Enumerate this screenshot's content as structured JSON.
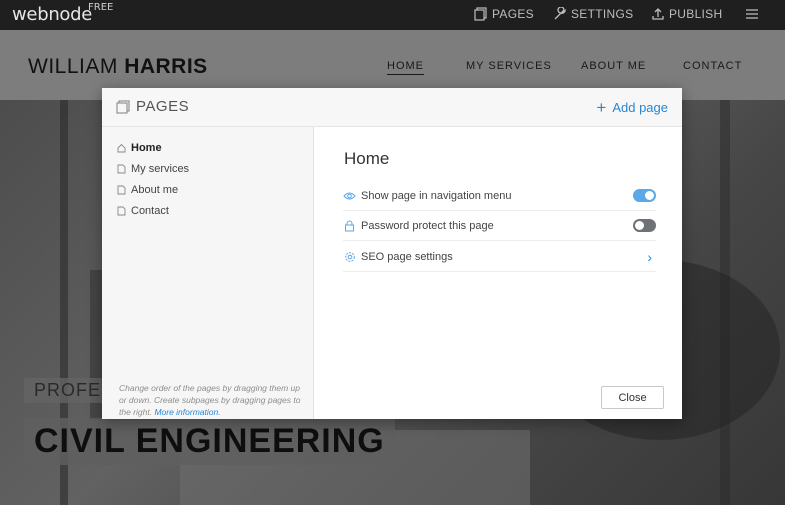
{
  "topbar": {
    "logo": "webnode",
    "badge": "FREE",
    "pages_label": "PAGES",
    "settings_label": "SETTINGS",
    "publish_label": "PUBLISH"
  },
  "site": {
    "brand_first": "WILLIAM ",
    "brand_last": "HARRIS",
    "nav": [
      "HOME",
      "MY SERVICES",
      "ABOUT ME",
      "CONTACT"
    ],
    "hero_tag": "PROFESS",
    "hero_title": "CIVIL ENGINEERING"
  },
  "modal": {
    "title": "PAGES",
    "add_page": "Add page",
    "pages": [
      {
        "label": "Home",
        "active": true,
        "icon": "home-icon"
      },
      {
        "label": "My services",
        "active": false,
        "icon": "page-icon"
      },
      {
        "label": "About me",
        "active": false,
        "icon": "page-icon"
      },
      {
        "label": "Contact",
        "active": false,
        "icon": "page-icon"
      }
    ],
    "hint_text": "Change order of the pages by dragging them up or down. Create subpages by dragging pages to the right. ",
    "hint_link": "More information.",
    "page_heading": "Home",
    "settings": [
      {
        "label": "Show page in navigation menu",
        "icon": "eye-icon",
        "toggle": "on"
      },
      {
        "label": "Password protect this page",
        "icon": "lock-icon",
        "toggle": "off"
      },
      {
        "label": "SEO page settings",
        "icon": "gear-icon",
        "chevron": true
      }
    ],
    "close_label": "Close"
  },
  "colors": {
    "accent": "#2b86d6",
    "toggle_on": "#5aa8e8",
    "toggle_off": "#6e7277",
    "topbar_bg": "#1f1f1f"
  }
}
